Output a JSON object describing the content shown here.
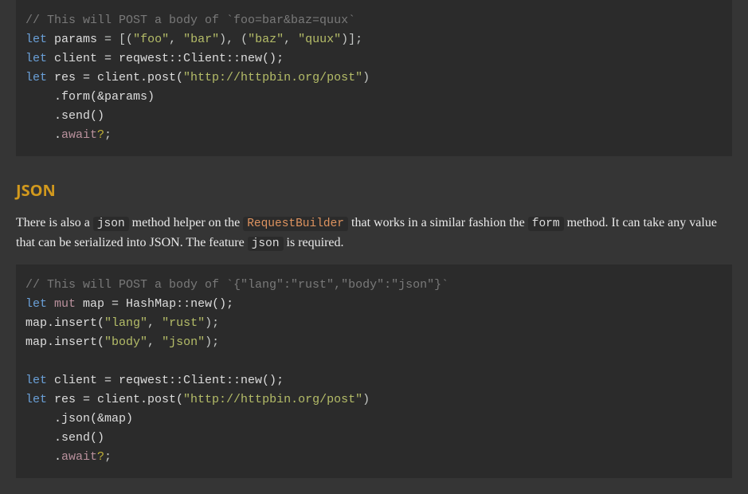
{
  "code1": {
    "comment": "// This will POST a body of `foo=bar&baz=quux`",
    "l2_let": "let",
    "l2_params": "params",
    "l2_eq": " = [(",
    "l2_s1": "\"foo\"",
    "l2_c1": ", ",
    "l2_s2": "\"bar\"",
    "l2_m": "), (",
    "l2_s3": "\"baz\"",
    "l2_c2": ", ",
    "l2_s4": "\"quux\"",
    "l2_end": ")];",
    "l3_let": "let",
    "l3_rest": " client = reqwest::Client::new();",
    "l4_let": "let",
    "l4_a": " res = client.post(",
    "l4_url": "\"http://httpbin.org/post\"",
    "l4_b": ")",
    "l5": "    .form(&params)",
    "l6": "    .send()",
    "l7_pre": "    .",
    "l7_await": "await",
    "l7_q": "?",
    "l7_semi": ";"
  },
  "heading": "JSON",
  "prose": {
    "p1": "There is also a ",
    "c1": "json",
    "p2": " method helper on the ",
    "c2": "RequestBuilder",
    "p3": " that works in a similar fashion the ",
    "c3": "form",
    "p4": " method. It can take any value that can be serialized into JSON. The feature ",
    "c4": "json",
    "p5": " is required."
  },
  "code2": {
    "comment": "// This will POST a body of `{\"lang\":\"rust\",\"body\":\"json\"}`",
    "l2_let": "let",
    "l2_sp": " ",
    "l2_mut": "mut",
    "l2_rest": " map = HashMap::new();",
    "l3_a": "map.insert(",
    "l3_s1": "\"lang\"",
    "l3_c": ", ",
    "l3_s2": "\"rust\"",
    "l3_b": ");",
    "l4_a": "map.insert(",
    "l4_s1": "\"body\"",
    "l4_c": ", ",
    "l4_s2": "\"json\"",
    "l4_b": ");",
    "blank": "",
    "l6_let": "let",
    "l6_rest": " client = reqwest::Client::new();",
    "l7_let": "let",
    "l7_a": " res = client.post(",
    "l7_url": "\"http://httpbin.org/post\"",
    "l7_b": ")",
    "l8": "    .json(&map)",
    "l9": "    .send()",
    "l10_pre": "    .",
    "l10_await": "await",
    "l10_q": "?",
    "l10_semi": ";"
  }
}
